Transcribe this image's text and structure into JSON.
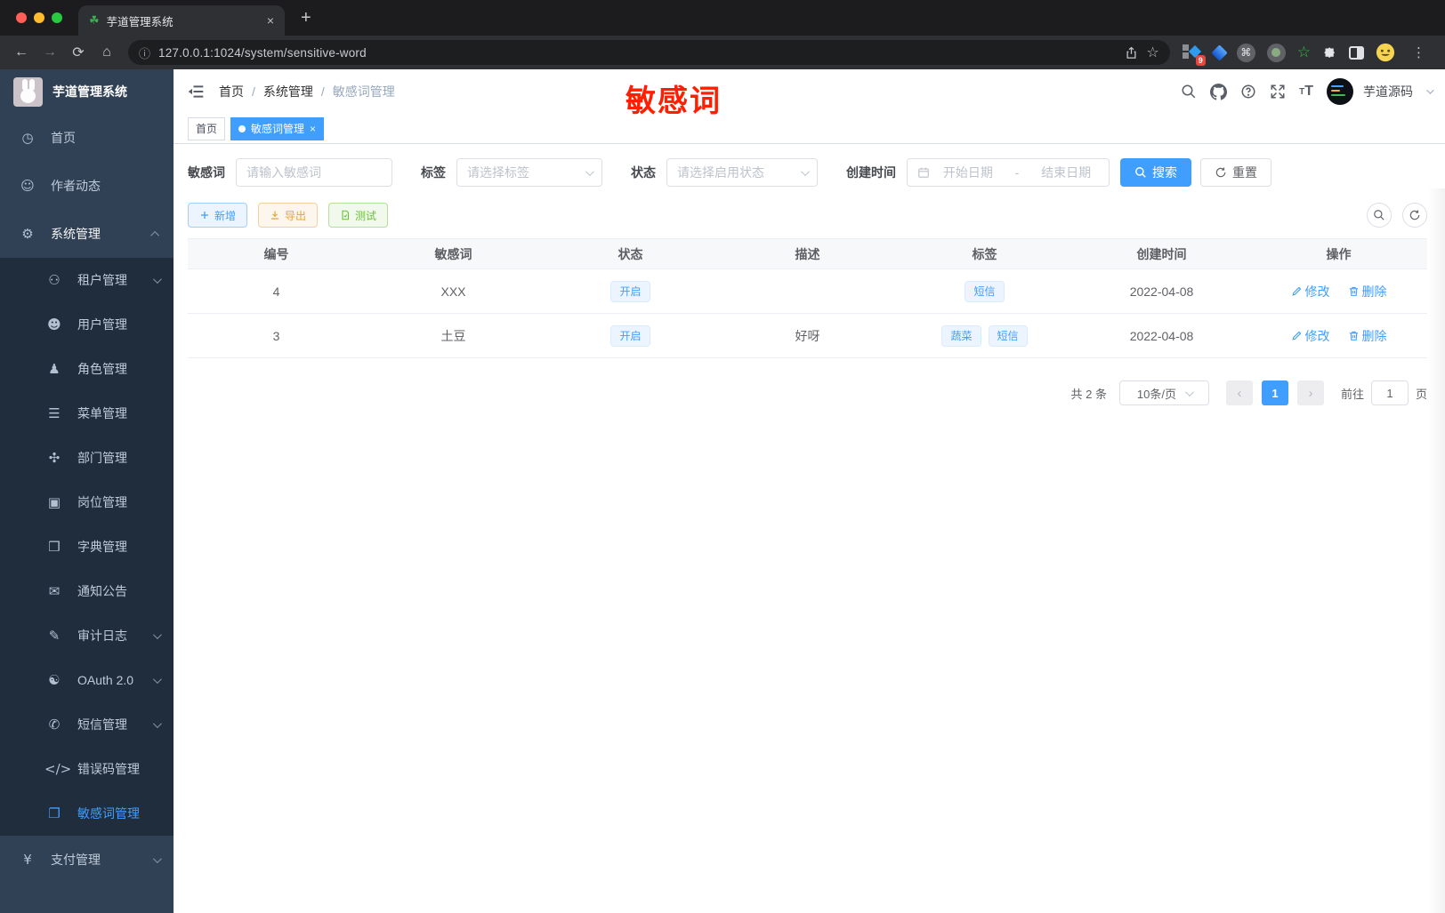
{
  "browser": {
    "tab": {
      "title": "芋道管理系统"
    },
    "new_tab_label": "+",
    "nav": {
      "url": "127.0.0.1:1024/system/sensitive-word"
    },
    "extensions_badge": "9",
    "traffic_colors": {
      "close": "#ff5f57",
      "minimize": "#febc2e",
      "zoom": "#28c840"
    }
  },
  "sidebar": {
    "logo_title": "芋道管理系统",
    "menu": [
      {
        "key": "home",
        "label": "首页",
        "icon": "dashboard-icon",
        "level": 1
      },
      {
        "key": "author-feed",
        "label": "作者动态",
        "icon": "author-icon",
        "level": 1
      },
      {
        "key": "system",
        "label": "系统管理",
        "icon": "gear-icon",
        "level": 1,
        "arrow": "up",
        "open": true
      },
      {
        "key": "tenant",
        "label": "租户管理",
        "icon": "tenant-icon",
        "level": 2,
        "arrow": "down"
      },
      {
        "key": "user",
        "label": "用户管理",
        "icon": "user-icon",
        "level": 2
      },
      {
        "key": "role",
        "label": "角色管理",
        "icon": "role-icon",
        "level": 2
      },
      {
        "key": "menu",
        "label": "菜单管理",
        "icon": "menu-tree-icon",
        "level": 2
      },
      {
        "key": "dept",
        "label": "部门管理",
        "icon": "org-icon",
        "level": 2
      },
      {
        "key": "post",
        "label": "岗位管理",
        "icon": "badge-icon",
        "level": 2
      },
      {
        "key": "dict",
        "label": "字典管理",
        "icon": "dict-icon",
        "level": 2
      },
      {
        "key": "notice",
        "label": "通知公告",
        "icon": "notice-icon",
        "level": 2
      },
      {
        "key": "audit-log",
        "label": "审计日志",
        "icon": "audit-icon",
        "level": 2,
        "arrow": "down"
      },
      {
        "key": "oauth2",
        "label": "OAuth 2.0",
        "icon": "oauth-icon",
        "level": 2,
        "arrow": "down"
      },
      {
        "key": "sms",
        "label": "短信管理",
        "icon": "shield-icon",
        "level": 2,
        "arrow": "down"
      },
      {
        "key": "error-code",
        "label": "错误码管理",
        "icon": "code-icon",
        "level": 2
      },
      {
        "key": "sensitive-word",
        "label": "敏感词管理",
        "icon": "book-icon",
        "level": 2,
        "active": true
      },
      {
        "key": "pay",
        "label": "支付管理",
        "icon": "yen-icon",
        "level": 1,
        "arrow": "down"
      }
    ]
  },
  "navbar": {
    "breadcrumb": [
      "首页",
      "系统管理",
      "敏感词管理"
    ],
    "annotation": "敏感词",
    "user_name": "芋道源码"
  },
  "tags_view": [
    {
      "key": "home",
      "label": "首页",
      "active": false,
      "closable": false
    },
    {
      "key": "sensitive-word",
      "label": "敏感词管理",
      "active": true,
      "closable": true
    }
  ],
  "filters": {
    "keyword": {
      "label": "敏感词",
      "placeholder": "请输入敏感词",
      "value": ""
    },
    "tag": {
      "label": "标签",
      "placeholder": "请选择标签",
      "value": ""
    },
    "status": {
      "label": "状态",
      "placeholder": "请选择启用状态",
      "value": ""
    },
    "create_time": {
      "label": "创建时间",
      "start_placeholder": "开始日期",
      "separator": "-",
      "end_placeholder": "结束日期"
    },
    "search_label": "搜索",
    "reset_label": "重置"
  },
  "toolbar": {
    "add": "新增",
    "export": "导出",
    "test": "测试"
  },
  "table": {
    "columns": [
      "编号",
      "敏感词",
      "状态",
      "描述",
      "标签",
      "创建时间",
      "操作"
    ],
    "rows": [
      {
        "id": "4",
        "word": "XXX",
        "status": "开启",
        "description": "",
        "tags": [
          "短信"
        ],
        "create_time": "2022-04-08"
      },
      {
        "id": "3",
        "word": "土豆",
        "status": "开启",
        "description": "好呀",
        "tags": [
          "蔬菜",
          "短信"
        ],
        "create_time": "2022-04-08"
      }
    ],
    "actions": {
      "edit": "修改",
      "delete": "删除"
    }
  },
  "pagination": {
    "total_text": "共 2 条",
    "page_size": "10条/页",
    "current_page": "1",
    "goto_label": "前往",
    "goto_value": "1",
    "page_suffix": "页"
  },
  "colors": {
    "accent": "#409eff",
    "annotation": "#ff1e00",
    "sidebar_bg": "#304156",
    "submenu_bg": "#1f2d3d"
  }
}
